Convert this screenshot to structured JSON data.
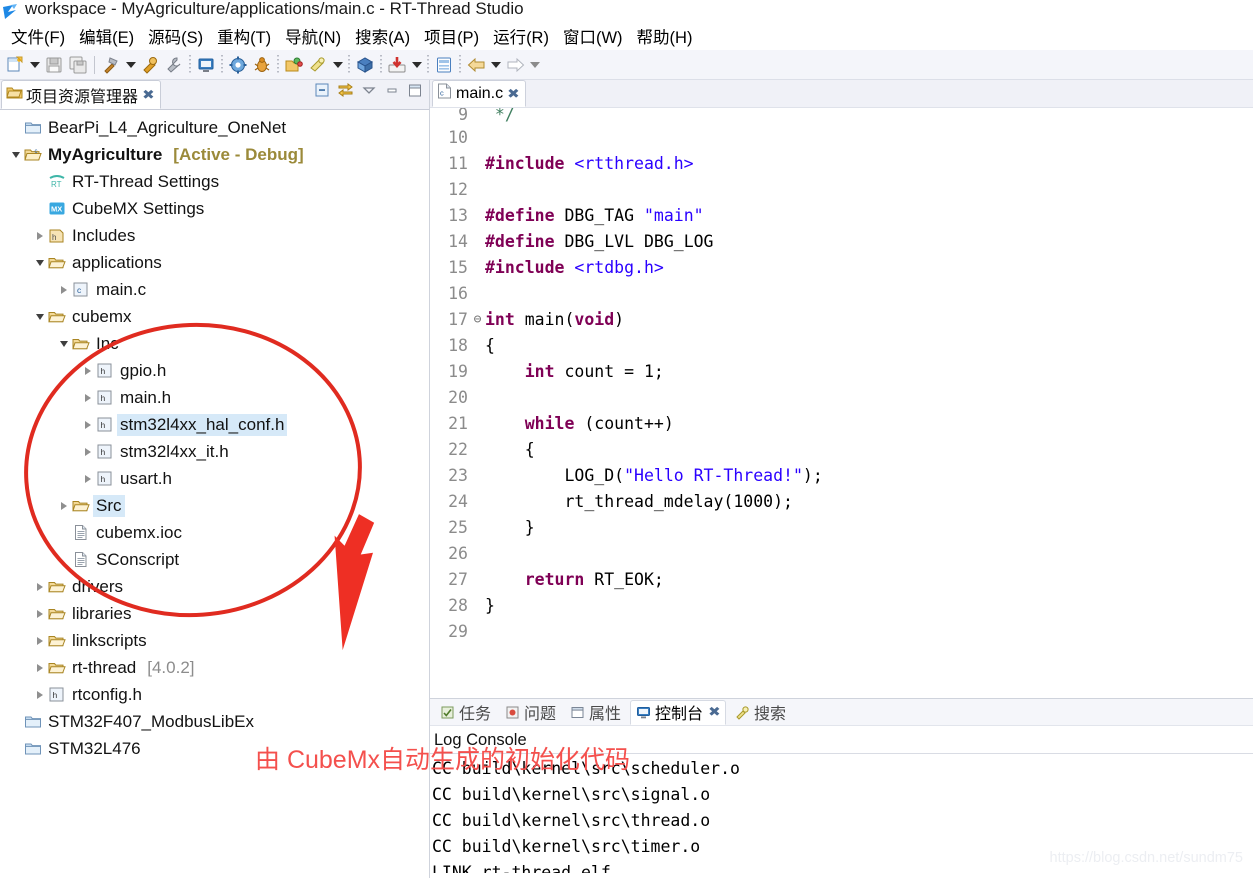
{
  "window": {
    "title": "workspace - MyAgriculture/applications/main.c - RT-Thread Studio",
    "app_icon": "rt-thread-logo-icon"
  },
  "menubar": {
    "items": [
      {
        "label": "文件(F)",
        "name": "menu-file"
      },
      {
        "label": "编辑(E)",
        "name": "menu-edit"
      },
      {
        "label": "源码(S)",
        "name": "menu-source"
      },
      {
        "label": "重构(T)",
        "name": "menu-refactor"
      },
      {
        "label": "导航(N)",
        "name": "menu-navigate"
      },
      {
        "label": "搜索(A)",
        "name": "menu-search"
      },
      {
        "label": "项目(P)",
        "name": "menu-project"
      },
      {
        "label": "运行(R)",
        "name": "menu-run"
      },
      {
        "label": "窗口(W)",
        "name": "menu-window"
      },
      {
        "label": "帮助(H)",
        "name": "menu-help"
      }
    ]
  },
  "toolbar": {
    "items": [
      {
        "name": "new-file-icon",
        "kind": "button"
      },
      {
        "name": "new-file-dropdown-icon",
        "kind": "arrow"
      },
      {
        "name": "save-icon",
        "kind": "button"
      },
      {
        "name": "save-all-icon",
        "kind": "button"
      },
      {
        "name": "separator",
        "kind": "sep"
      },
      {
        "name": "build-hammer-icon",
        "kind": "button"
      },
      {
        "name": "build-dropdown-icon",
        "kind": "arrow"
      },
      {
        "name": "clean-icon",
        "kind": "button"
      },
      {
        "name": "settings-wrench-icon",
        "kind": "button"
      },
      {
        "name": "dot-separator",
        "kind": "dotsep"
      },
      {
        "name": "terminal-icon",
        "kind": "button"
      },
      {
        "name": "dot-separator",
        "kind": "dotsep"
      },
      {
        "name": "run-config-icon",
        "kind": "button"
      },
      {
        "name": "debug-bug-icon",
        "kind": "button"
      },
      {
        "name": "dot-separator",
        "kind": "dotsep"
      },
      {
        "name": "open-package-icon",
        "kind": "button"
      },
      {
        "name": "flash-download-icon",
        "kind": "button"
      },
      {
        "name": "flash-dropdown-icon",
        "kind": "arrow"
      },
      {
        "name": "dot-separator",
        "kind": "dotsep"
      },
      {
        "name": "sdk-manager-icon",
        "kind": "button"
      },
      {
        "name": "dot-separator",
        "kind": "dotsep"
      },
      {
        "name": "download-red-icon",
        "kind": "button"
      },
      {
        "name": "download-dropdown-icon",
        "kind": "arrow"
      },
      {
        "name": "dot-separator",
        "kind": "dotsep"
      },
      {
        "name": "resource-center-icon",
        "kind": "button"
      },
      {
        "name": "dot-separator",
        "kind": "dotsep"
      },
      {
        "name": "back-arrow-icon",
        "kind": "button"
      },
      {
        "name": "back-dropdown-icon",
        "kind": "arrow"
      },
      {
        "name": "forward-arrow-icon",
        "kind": "button"
      },
      {
        "name": "forward-dropdown-icon",
        "kind": "arrow-dim"
      }
    ]
  },
  "explorer": {
    "tab_label": "项目资源管理器",
    "close_glyph": "✖",
    "tools": [
      {
        "name": "collapse-all-icon"
      },
      {
        "name": "link-with-editor-icon"
      },
      {
        "name": "view-menu-icon"
      },
      {
        "name": "minimize-view-icon"
      },
      {
        "name": "maximize-view-icon"
      }
    ],
    "tree": [
      {
        "label": "BearPi_L4_Agriculture_OneNet",
        "indent": 0,
        "twisty": "none",
        "icon": "closed-project-icon"
      },
      {
        "label": "MyAgriculture",
        "suffix": "[Active - Debug]",
        "indent": 0,
        "twisty": "down",
        "icon": "open-project-icon",
        "bold": true
      },
      {
        "label": "RT-Thread Settings",
        "indent": 1,
        "twisty": "none",
        "icon": "rt-settings-icon"
      },
      {
        "label": "CubeMX Settings",
        "indent": 1,
        "twisty": "none",
        "icon": "cubemx-settings-icon"
      },
      {
        "label": "Includes",
        "indent": 1,
        "twisty": "right",
        "icon": "includes-icon"
      },
      {
        "label": "applications",
        "indent": 1,
        "twisty": "down",
        "icon": "folder-icon"
      },
      {
        "label": "main.c",
        "indent": 2,
        "twisty": "right",
        "icon": "c-file-icon"
      },
      {
        "label": "cubemx",
        "indent": 1,
        "twisty": "down",
        "icon": "folder-icon"
      },
      {
        "label": "Inc",
        "indent": 2,
        "twisty": "down",
        "icon": "folder-icon"
      },
      {
        "label": "gpio.h",
        "indent": 3,
        "twisty": "right",
        "icon": "h-file-icon"
      },
      {
        "label": "main.h",
        "indent": 3,
        "twisty": "right",
        "icon": "h-file-icon"
      },
      {
        "label": "stm32l4xx_hal_conf.h",
        "indent": 3,
        "twisty": "right",
        "icon": "h-file-icon",
        "selected": true
      },
      {
        "label": "stm32l4xx_it.h",
        "indent": 3,
        "twisty": "right",
        "icon": "h-file-icon"
      },
      {
        "label": "usart.h",
        "indent": 3,
        "twisty": "right",
        "icon": "h-file-icon"
      },
      {
        "label": "Src",
        "indent": 2,
        "twisty": "right",
        "icon": "folder-icon",
        "selected": true
      },
      {
        "label": "cubemx.ioc",
        "indent": 2,
        "twisty": "none",
        "icon": "doc-file-icon"
      },
      {
        "label": "SConscript",
        "indent": 2,
        "twisty": "none",
        "icon": "doc-file-icon"
      },
      {
        "label": "drivers",
        "indent": 1,
        "twisty": "right",
        "icon": "folder-icon"
      },
      {
        "label": "libraries",
        "indent": 1,
        "twisty": "right",
        "icon": "folder-icon"
      },
      {
        "label": "linkscripts",
        "indent": 1,
        "twisty": "right",
        "icon": "folder-icon"
      },
      {
        "label": "rt-thread",
        "suffix": "[4.0.2]",
        "suffix_gray": true,
        "indent": 1,
        "twisty": "right",
        "icon": "folder-icon"
      },
      {
        "label": "rtconfig.h",
        "indent": 1,
        "twisty": "right",
        "icon": "h-file-icon"
      },
      {
        "label": "STM32F407_ModbusLibEx",
        "indent": 0,
        "twisty": "none",
        "icon": "closed-project-icon"
      },
      {
        "label": "STM32L476",
        "indent": 0,
        "twisty": "none",
        "icon": "closed-project-icon"
      }
    ]
  },
  "annotation": {
    "text": "由 CubeMx自动生成的初始化代码",
    "color": "#f4504d",
    "ellipse_name": "red-ellipse-highlight",
    "arrow_name": "red-arrow-pointer"
  },
  "editor": {
    "tab_label": "main.c",
    "tab_icon": "c-file-icon",
    "close_glyph": "✖",
    "lines": [
      {
        "num": "9",
        "fold": "",
        "partial": true,
        "tokens": [
          {
            "t": " */",
            "c": "cmt"
          }
        ]
      },
      {
        "num": "10",
        "fold": "",
        "tokens": []
      },
      {
        "num": "11",
        "fold": "",
        "tokens": [
          {
            "t": "#include ",
            "c": "pre"
          },
          {
            "t": "<rtthread.h>",
            "c": "inc"
          }
        ]
      },
      {
        "num": "12",
        "fold": "",
        "tokens": []
      },
      {
        "num": "13",
        "fold": "",
        "tokens": [
          {
            "t": "#define ",
            "c": "pre"
          },
          {
            "t": "DBG_TAG ",
            "c": ""
          },
          {
            "t": "\"main\"",
            "c": "str"
          }
        ]
      },
      {
        "num": "14",
        "fold": "",
        "tokens": [
          {
            "t": "#define ",
            "c": "pre"
          },
          {
            "t": "DBG_LVL DBG_LOG",
            "c": ""
          }
        ]
      },
      {
        "num": "15",
        "fold": "",
        "tokens": [
          {
            "t": "#include ",
            "c": "pre"
          },
          {
            "t": "<rtdbg.h>",
            "c": "inc"
          }
        ]
      },
      {
        "num": "16",
        "fold": "",
        "tokens": []
      },
      {
        "num": "17",
        "fold": "⊖",
        "tokens": [
          {
            "t": "int ",
            "c": "kw"
          },
          {
            "t": "main(",
            "c": ""
          },
          {
            "t": "void",
            "c": "kw"
          },
          {
            "t": ")",
            "c": ""
          }
        ]
      },
      {
        "num": "18",
        "fold": "",
        "tokens": [
          {
            "t": "{",
            "c": ""
          }
        ]
      },
      {
        "num": "19",
        "fold": "",
        "tokens": [
          {
            "t": "    ",
            "c": ""
          },
          {
            "t": "int ",
            "c": "kw"
          },
          {
            "t": "count = 1;",
            "c": ""
          }
        ]
      },
      {
        "num": "20",
        "fold": "",
        "tokens": []
      },
      {
        "num": "21",
        "fold": "",
        "tokens": [
          {
            "t": "    ",
            "c": ""
          },
          {
            "t": "while ",
            "c": "kw"
          },
          {
            "t": "(count++)",
            "c": ""
          }
        ]
      },
      {
        "num": "22",
        "fold": "",
        "tokens": [
          {
            "t": "    {",
            "c": ""
          }
        ]
      },
      {
        "num": "23",
        "fold": "",
        "tokens": [
          {
            "t": "        LOG_D(",
            "c": ""
          },
          {
            "t": "\"Hello RT-Thread!\"",
            "c": "str"
          },
          {
            "t": ");",
            "c": ""
          }
        ]
      },
      {
        "num": "24",
        "fold": "",
        "tokens": [
          {
            "t": "        rt_thread_mdelay(1000);",
            "c": ""
          }
        ]
      },
      {
        "num": "25",
        "fold": "",
        "tokens": [
          {
            "t": "    }",
            "c": ""
          }
        ]
      },
      {
        "num": "26",
        "fold": "",
        "tokens": []
      },
      {
        "num": "27",
        "fold": "",
        "tokens": [
          {
            "t": "    ",
            "c": ""
          },
          {
            "t": "return ",
            "c": "kw"
          },
          {
            "t": "RT_EOK;",
            "c": ""
          }
        ]
      },
      {
        "num": "28",
        "fold": "",
        "tokens": [
          {
            "t": "}",
            "c": ""
          }
        ]
      },
      {
        "num": "29",
        "fold": "",
        "tokens": []
      }
    ]
  },
  "bottom_panel": {
    "tabs": [
      {
        "label": "任务",
        "icon": "tasks-icon",
        "active": false,
        "name": "tab-tasks"
      },
      {
        "label": "问题",
        "icon": "problems-icon",
        "active": false,
        "name": "tab-problems"
      },
      {
        "label": "属性",
        "icon": "properties-icon",
        "active": false,
        "name": "tab-properties"
      },
      {
        "label": "控制台",
        "icon": "console-icon",
        "active": true,
        "name": "tab-console",
        "close_glyph": "✖"
      },
      {
        "label": "搜索",
        "icon": "search-icon",
        "active": false,
        "name": "tab-search"
      }
    ],
    "console_title": "Log Console",
    "console_lines": [
      "CC build\\kernel\\src\\scheduler.o",
      "CC build\\kernel\\src\\signal.o",
      "CC build\\kernel\\src\\thread.o",
      "CC build\\kernel\\src\\timer.o",
      "LINK rt-thread.elf"
    ]
  },
  "watermark": {
    "text": "https://blog.csdn.net/sundm75"
  }
}
